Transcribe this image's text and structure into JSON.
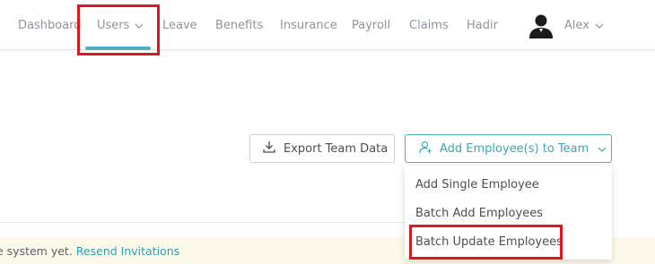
{
  "nav": {
    "items": [
      {
        "label": "Dashboard"
      },
      {
        "label": "Users",
        "active": true,
        "has_dropdown": true
      },
      {
        "label": "Leave"
      },
      {
        "label": "Benefits"
      },
      {
        "label": "Insurance"
      },
      {
        "label": "Payroll"
      },
      {
        "label": "Claims"
      },
      {
        "label": "Hadir"
      }
    ],
    "user": {
      "name": "Alex",
      "has_dropdown": true
    }
  },
  "toolbar": {
    "export_label": "Export Team Data",
    "add_label": "Add Employee(s) to Team"
  },
  "dropdown": {
    "items": [
      {
        "label": "Add Single Employee"
      },
      {
        "label": "Batch Add Employees"
      },
      {
        "label": "Batch Update Employees",
        "highlighted": true
      }
    ]
  },
  "notice": {
    "text": "e system yet.",
    "link": "Resend Invitations"
  },
  "colors": {
    "accent": "#4ab3bf",
    "highlight": "#e0161d",
    "notice_bg": "#fdf9ea"
  },
  "icons": [
    "chevron-down-icon",
    "user-avatar-icon",
    "download-icon",
    "user-plus-icon"
  ]
}
